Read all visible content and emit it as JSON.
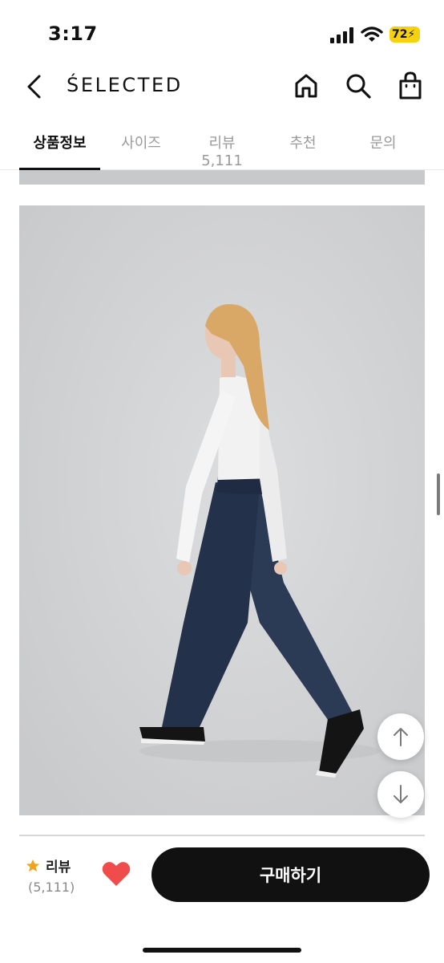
{
  "status_bar": {
    "time": "3:17",
    "battery": "72"
  },
  "header": {
    "brand": "ŚELECTED",
    "icons": [
      "back-icon",
      "home-icon",
      "search-icon",
      "shopping-bag-icon"
    ]
  },
  "tabs": [
    {
      "label": "상품정보",
      "active": true
    },
    {
      "label": "사이즈",
      "active": false
    },
    {
      "label": "리뷰 5,111",
      "active": false
    },
    {
      "label": "추천",
      "active": false
    },
    {
      "label": "문의",
      "active": false
    }
  ],
  "bottom_bar": {
    "review_label": "리뷰",
    "review_count": "(5,111)",
    "buy_button": "구매하기"
  },
  "colors": {
    "accent": "#111111",
    "star": "#f2a51a",
    "heart": "#f04c4c",
    "battery": "#f5d20b"
  }
}
